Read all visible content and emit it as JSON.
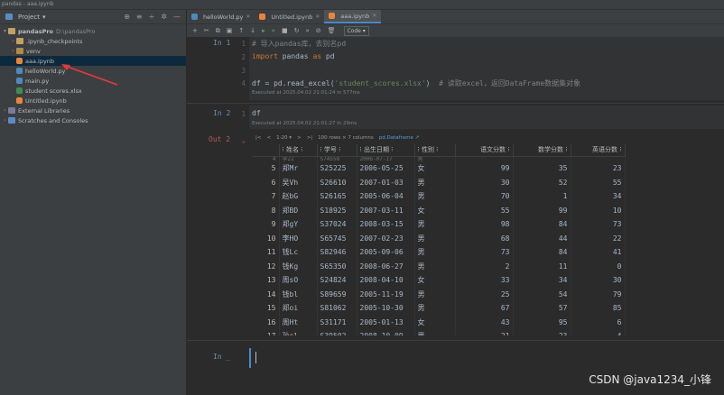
{
  "window": {
    "title": "pandas - aaa.ipynb"
  },
  "project_panel": {
    "title": "Project",
    "items": [
      {
        "label": "pandasPro",
        "path": "D:\\pandasPro"
      },
      {
        "label": ".ipynb_checkpoints"
      },
      {
        "label": "venv"
      },
      {
        "label": "aaa.ipynb"
      },
      {
        "label": "helloWorld.py"
      },
      {
        "label": "main.py"
      },
      {
        "label": "student scores.xlsx"
      },
      {
        "label": "Untitled.ipynb"
      },
      {
        "label": "External Libraries"
      },
      {
        "label": "Scratches and Consoles"
      }
    ]
  },
  "tabs": [
    {
      "label": "helloWorld.py"
    },
    {
      "label": "Untitled.ipynb"
    },
    {
      "label": "aaa.ipynb"
    }
  ],
  "toolbar": {
    "cell_type": "Code"
  },
  "cells": {
    "in1": {
      "label": "In 1",
      "line1": "# 导入pandas库，去别名pd",
      "line2_kw": "import",
      "line2_mod": " pandas ",
      "line2_as": "as",
      "line2_alias": " pd",
      "line4_pre": "df = pd.read_excel(",
      "line4_str": "'student_scores.xlsx'",
      "line4_post": ")  ",
      "line4_comment": "# 读取excel，返回DataFrame数据集对象",
      "executed": "Executed at 2025.04.02 21:01:24 in 577ms"
    },
    "in2": {
      "label": "In 2",
      "line1": "df",
      "executed": "Executed at 2025.04.02 21:01:27 in 29ms"
    },
    "out2": {
      "label": "Out 2"
    },
    "last": {
      "label": "In _"
    }
  },
  "pager": {
    "range": "1-20",
    "info": "100 rows × 7 columns",
    "type_link": "pd.Dataframe ↗"
  },
  "dataframe": {
    "columns": [
      "",
      "姓名",
      "学号",
      "出生日期",
      "性别",
      "语文分数",
      "数学分数",
      "英语分数"
    ],
    "cut_row": [
      "4",
      "李ZZ",
      "S74558",
      "2006-07-17",
      "男",
      "",
      "",
      ""
    ],
    "rows": [
      [
        "5",
        "郑Mr",
        "S25225",
        "2006-05-25",
        "女",
        "99",
        "35",
        "23"
      ],
      [
        "6",
        "吴Vh",
        "S26610",
        "2007-01-03",
        "男",
        "30",
        "52",
        "55"
      ],
      [
        "7",
        "赵bG",
        "S26165",
        "2005-06-04",
        "男",
        "70",
        "1",
        "34"
      ],
      [
        "8",
        "郑BD",
        "S18925",
        "2007-03-11",
        "女",
        "55",
        "99",
        "10"
      ],
      [
        "9",
        "郑gY",
        "S37024",
        "2008-03-15",
        "男",
        "98",
        "84",
        "73"
      ],
      [
        "10",
        "李HO",
        "S65745",
        "2007-02-23",
        "男",
        "68",
        "44",
        "22"
      ],
      [
        "11",
        "钱Lc",
        "S82946",
        "2005-09-06",
        "男",
        "73",
        "84",
        "41"
      ],
      [
        "12",
        "钱Kg",
        "S65350",
        "2008-06-27",
        "男",
        "2",
        "11",
        "0"
      ],
      [
        "13",
        "周sO",
        "S24824",
        "2008-04-10",
        "女",
        "33",
        "34",
        "30"
      ],
      [
        "14",
        "钱bl",
        "S89659",
        "2005-11-19",
        "男",
        "25",
        "54",
        "79"
      ],
      [
        "15",
        "郑oi",
        "S81062",
        "2005-10-30",
        "男",
        "67",
        "57",
        "85"
      ],
      [
        "16",
        "周Ht",
        "S31171",
        "2005-01-13",
        "女",
        "43",
        "95",
        "6"
      ],
      [
        "17",
        "孙cl",
        "S39502",
        "2008-10-09",
        "男",
        "21",
        "23",
        "4"
      ]
    ]
  },
  "watermark": "CSDN @java1234_小锋"
}
